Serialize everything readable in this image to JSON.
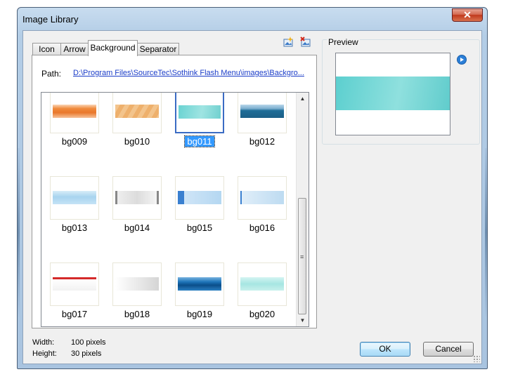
{
  "window": {
    "title": "Image Library",
    "close_glyph": "✕"
  },
  "tabs": [
    {
      "label": "Icon",
      "active": false
    },
    {
      "label": "Arrow",
      "active": false
    },
    {
      "label": "Background",
      "active": true
    },
    {
      "label": "Separator",
      "active": false
    }
  ],
  "toolbar": {
    "add_icon": "add-image-icon",
    "delete_icon": "delete-image-icon"
  },
  "path": {
    "label": "Path:",
    "value": "D:\\Program Files\\SourceTec\\Sothink Flash Menu\\images\\Backgro..."
  },
  "grid": {
    "items": [
      {
        "name": "bg009",
        "selected": false,
        "style": "orange-gradient"
      },
      {
        "name": "bg010",
        "selected": false,
        "style": "orange-diagonal"
      },
      {
        "name": "bg011",
        "selected": true,
        "style": "teal"
      },
      {
        "name": "bg012",
        "selected": false,
        "style": "dark-blue"
      },
      {
        "name": "bg013",
        "selected": false,
        "style": "light-blue"
      },
      {
        "name": "bg014",
        "selected": false,
        "style": "gray-capped"
      },
      {
        "name": "bg015",
        "selected": false,
        "style": "blue-left-cap"
      },
      {
        "name": "bg016",
        "selected": false,
        "style": "pale-blue-left-line"
      },
      {
        "name": "bg017",
        "selected": false,
        "style": "red-top-white"
      },
      {
        "name": "bg018",
        "selected": false,
        "style": "gray-fade"
      },
      {
        "name": "bg019",
        "selected": false,
        "style": "deep-blue"
      },
      {
        "name": "bg020",
        "selected": false,
        "style": "aqua"
      }
    ]
  },
  "preview": {
    "label": "Preview",
    "style": "teal",
    "play_icon": "play-icon"
  },
  "info": {
    "width_label": "Width:",
    "width_value": "100 pixels",
    "height_label": "Height:",
    "height_value": "30 pixels"
  },
  "buttons": {
    "ok": "OK",
    "cancel": "Cancel"
  },
  "colors": {
    "accent": "#3399ff",
    "selection_border": "#3b6cc4",
    "link": "#1a3cc8"
  }
}
